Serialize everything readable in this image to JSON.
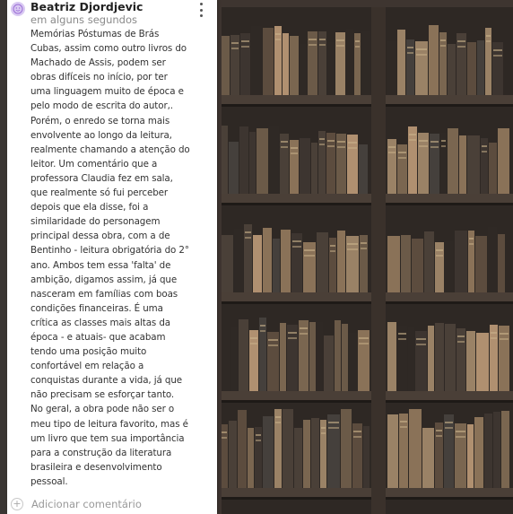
{
  "post": {
    "author": "Beatriz Djordjevic",
    "timestamp": "em alguns segundos",
    "body": "Memórias Póstumas de Brás\nCubas, assim como outro livros do\nMachado de Assis, podem ser\nobras difíceis no início, por ter\numa linguagem muito de época e\npelo modo de escrita do autor,.\nPorém, o enredo se torna mais\nenvolvente ao longo da leitura,\nrealmente chamando a atenção do\nleitor. Um comentário que a\nprofessora Claudia fez em sala,\nque realmente só fui perceber\ndepois que ela disse, foi a\nsimilaridade do personagem\nprincipal dessa obra, com a de\nBentinho - leitura obrigatória do 2°\nano. Ambos tem essa 'falta' de\nambição, digamos assim, já que\nnasceram em famílias com boas\ncondições financeiras. É uma\ncrítica as classes mais altas da\népoca - e atuais- que acabam\ntendo uma posição muito\nconfortável em relação a\nconquistas durante a vida, já que\nnão precisam se esforçar tanto.\nNo geral, a obra pode não ser o\nmeu tipo de leitura favorito, mas é\num livro que tem sua importância\npara a construção da literatura\nbrasileira e desenvolvimento\npessoal.",
    "add_comment_label": "Adicionar comentário",
    "icons": {
      "avatar": "user-avatar-icon",
      "menu": "more-vert-icon",
      "add": "plus-circle-icon"
    }
  },
  "colors": {
    "card": "#ffffff",
    "avatar": "#d9c9f2",
    "background": "#2c2622"
  }
}
